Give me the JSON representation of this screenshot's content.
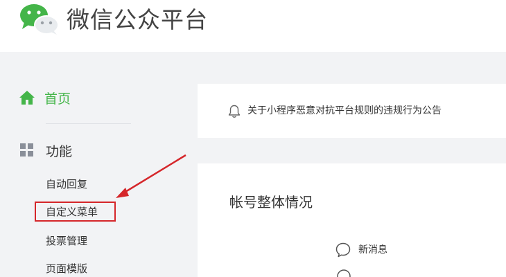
{
  "header": {
    "title": "微信公众平台",
    "logo_icon": "wechat-logo-icon"
  },
  "sidebar": {
    "home": {
      "label": "首页",
      "icon": "home-icon",
      "active_color": "#44b549"
    },
    "function": {
      "label": "功能",
      "icon": "grid-icon"
    },
    "items": [
      {
        "label": "自动回复"
      },
      {
        "label": "自定义菜单",
        "highlighted": true
      },
      {
        "label": "投票管理"
      },
      {
        "label": "页面模版"
      }
    ]
  },
  "notice": {
    "icon": "bell-icon",
    "text": "关于小程序恶意对抗平台规则的违规行为公告"
  },
  "account": {
    "title": "帐号整体情况",
    "stats": [
      {
        "label": "新消息",
        "icon": "chat-bubble-icon"
      }
    ]
  },
  "annotation": {
    "highlight_color": "#d5262a",
    "arrow_color": "#d5262a"
  }
}
